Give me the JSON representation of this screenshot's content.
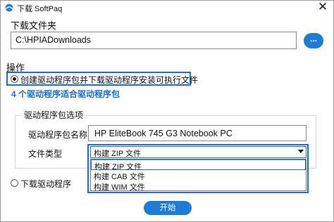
{
  "window": {
    "title": "下载 SoftPaq",
    "close_glyph": "✕"
  },
  "download_folder": {
    "label": "下载文件夹",
    "path": "C:\\HPIADownloads",
    "browse_label": "..."
  },
  "operation": {
    "label": "操作",
    "option_create": {
      "label": "创建驱动程序包并下载驱动程序安装可执行文件",
      "checked": true
    },
    "package_count_text": "4 个驱动程序适合驱动程序包",
    "option_download": {
      "label": "下载驱动程序",
      "checked": false
    }
  },
  "package_options": {
    "group_label": "驱动程序包选项",
    "name_label": "驱动程序包名称",
    "name_value": "HP EliteBook 745 G3 Notebook PC",
    "filetype_label": "文件类型",
    "filetype_selected": "构建 ZIP 文件",
    "filetype_options": [
      "构建 ZIP 文件",
      "构建 CAB 文件",
      "构建 WIM 文件"
    ]
  },
  "start_button": {
    "label": "开始"
  },
  "colors": {
    "accent": "#1c7cd6",
    "highlight_border": "#1e6fd0",
    "count_text": "#1b6fcf"
  }
}
